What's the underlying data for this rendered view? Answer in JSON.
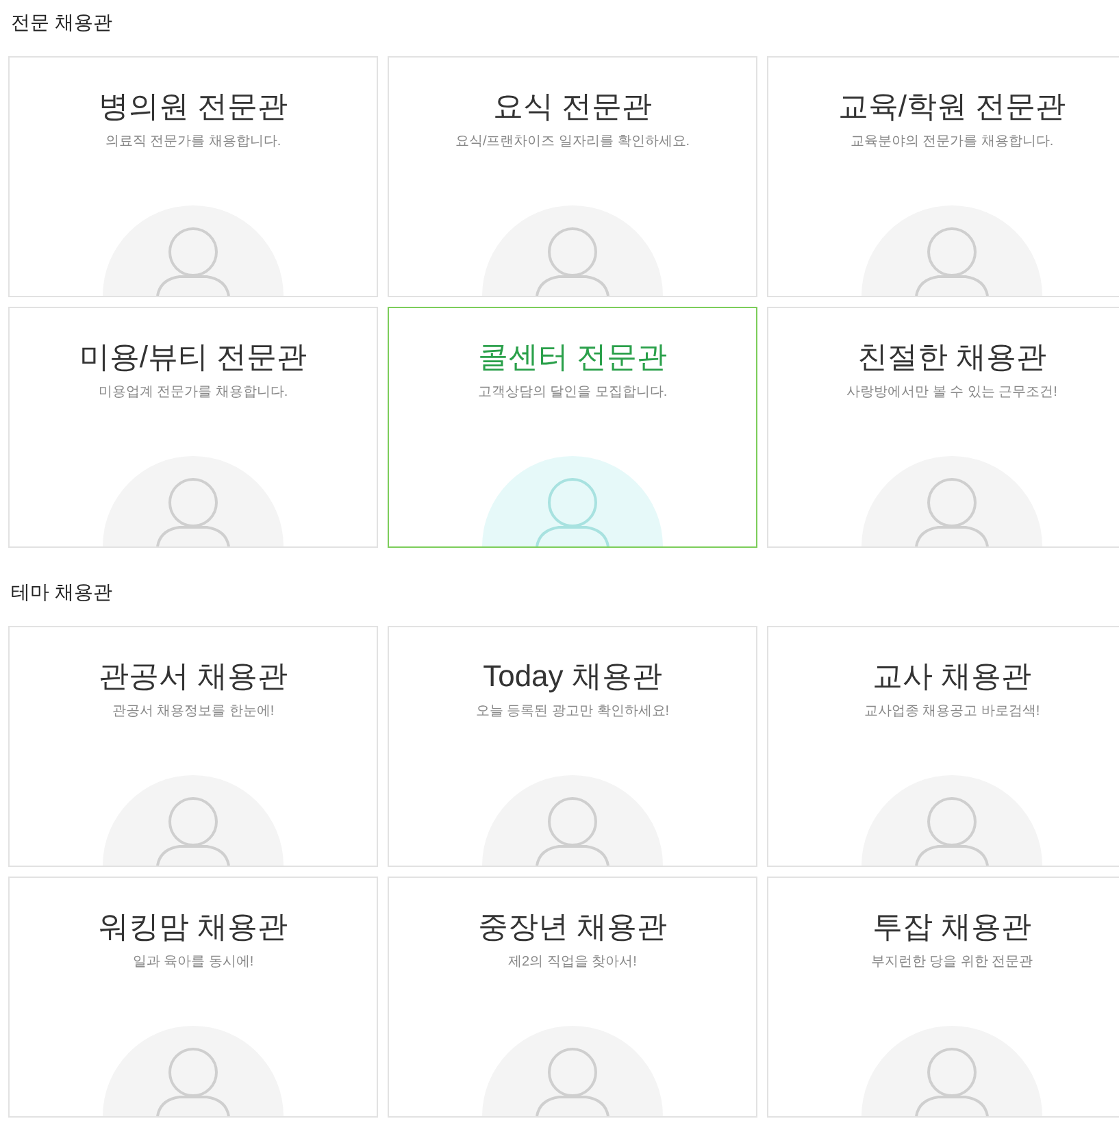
{
  "sections": [
    {
      "title": "전문 채용관",
      "cards": [
        {
          "title": "**병의원** 전문관",
          "description": "의료직 전문가를 채용합니다.",
          "selected": false
        },
        {
          "title": "**요식** 전문관",
          "description": "요식/프랜차이즈 일자리를 확인하세요.",
          "selected": false
        },
        {
          "title": "**교육/학원** 전문관",
          "description": "교육분야의 전문가를 채용합니다.",
          "selected": false
        },
        {
          "title": "**미용/뷰티** 전문관",
          "description": "미용업계 전문가를 채용합니다.",
          "selected": false
        },
        {
          "title": "**콜센터** 전문관",
          "description": "고객상담의 달인을 모집합니다.",
          "selected": true
        },
        {
          "title": "**친절한** 채용관",
          "description": "사랑방에서만 볼 수 있는 근무조건!",
          "selected": false
        }
      ]
    },
    {
      "title": "테마 채용관",
      "cards": [
        {
          "title": "**관공서** 채용관",
          "description": "관공서 채용정보를 한눈에!",
          "selected": false
        },
        {
          "title": "**Today** 채용관",
          "description": "오늘 등록된 광고만 확인하세요!",
          "selected": false
        },
        {
          "title": "**교사** 채용관",
          "description": "교사업종 채용공고 바로검색!",
          "selected": false
        },
        {
          "title": "**워킹맘** 채용관",
          "description": "일과 육아를 동시에!",
          "selected": false
        },
        {
          "title": "**중장년** 채용관",
          "description": "제2의 직업을 찾아서!",
          "selected": false
        },
        {
          "title": "**투잡** 채용관",
          "description": "부지런한 당을 위한 전문관",
          "selected": false
        }
      ]
    }
  ]
}
